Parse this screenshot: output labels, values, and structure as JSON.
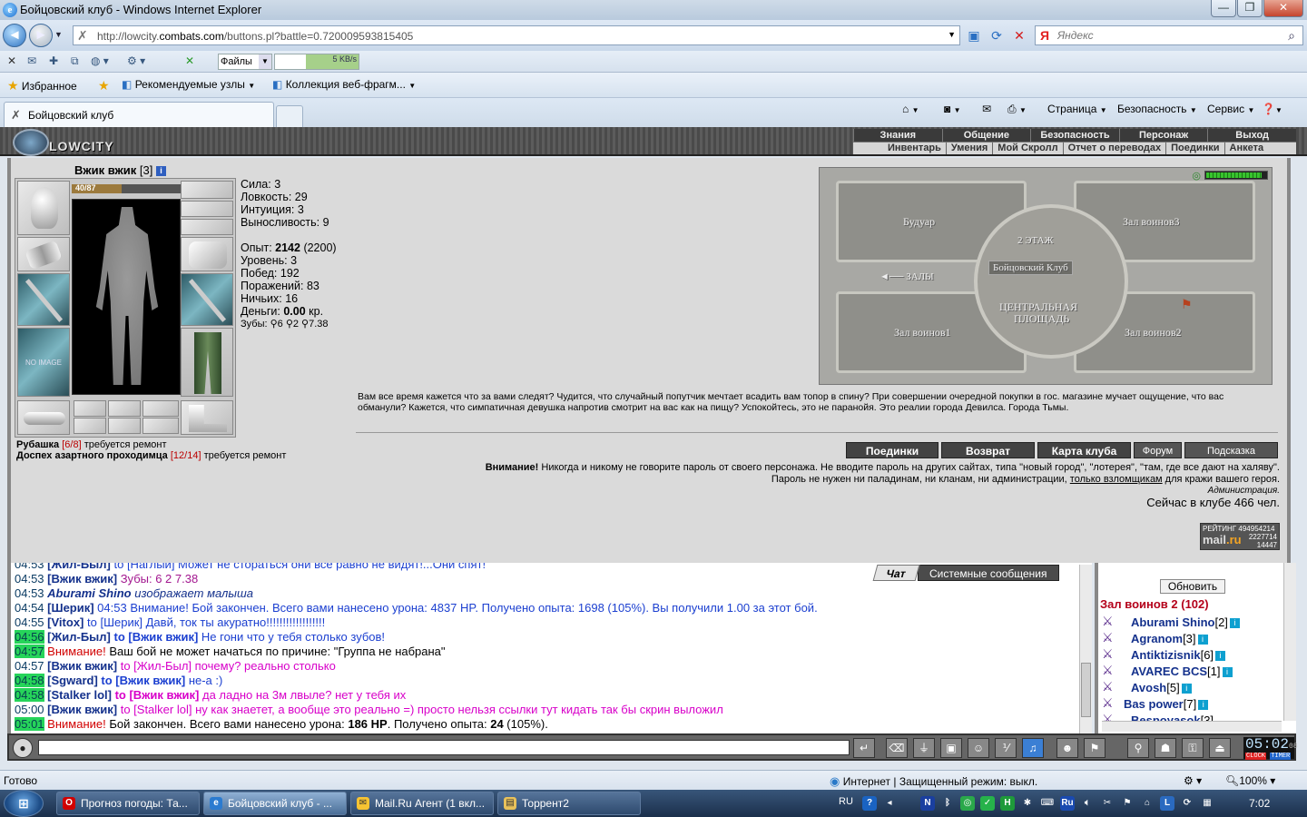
{
  "window": {
    "title": "Бойцовский клуб - Windows Internet Explorer"
  },
  "address": {
    "url_prefix": "http://lowcity.",
    "url_domain": "combats.com",
    "url_path": "/buttons.pl?battle=0.720009593815405",
    "search_placeholder": "Яндекс",
    "search_logo": "Я"
  },
  "toolbar": {
    "files_label": "Файлы",
    "speed_label": "5 KB/s"
  },
  "favorites": {
    "favorites_label": "Избранное",
    "recommended_label": "Рекомендуемые узлы",
    "webslices_label": "Коллекция веб-фрагм..."
  },
  "tab": {
    "label": "Бойцовский клуб"
  },
  "commandbar": {
    "page_label": "Страница",
    "security_label": "Безопасность",
    "service_label": "Сервис"
  },
  "game": {
    "logo": "LOWCITY",
    "menu_top": [
      "Знания",
      "Общение",
      "Безопасность",
      "Персонаж",
      "Выход"
    ],
    "menu_bottom": [
      "Инвентарь",
      "Умения",
      "Мой Скролл",
      "Отчет о переводах",
      "Поединки",
      "Анкета"
    ],
    "character": {
      "name": "Вжик вжик",
      "level": "[3]",
      "hp_text": "40/87",
      "hp_fraction": 0.46,
      "no_image": "NO IMAGE"
    },
    "stats": {
      "strength": "Сила: 3",
      "agility": "Ловкость: 29",
      "intuition": "Интуиция: 3",
      "endurance": "Выносливость: 9",
      "exp_label": "Опыт: ",
      "exp_value": "2142",
      "exp_next": " (2200)",
      "level": "Уровень: 3",
      "wins": "Побед: 192",
      "losses": "Поражений: 83",
      "draws": "Ничьих: 16",
      "money_label": "Деньги: ",
      "money_value": "0.00",
      "money_unit": " кр.",
      "teeth": "Зубы: ⚲6 ⚲2 ⚲7.38"
    },
    "repairs": [
      {
        "item": "Рубашка",
        "dur": "[6/8]",
        "note": " требуется ремонт"
      },
      {
        "item": "Доспех азартного проходимца",
        "dur": "[12/14]",
        "note": " требуется ремонт"
      }
    ],
    "map": {
      "boudoir": "Будуар",
      "hall3": "Зал воинов3",
      "floor2": "2 ЭТАЖ",
      "club": "Бойцовский Клуб",
      "halls": "◄── ЗАЛЫ",
      "central1": "ЦЕНТРАЛЬНАЯ",
      "central2": "ПЛОЩАДЬ",
      "hall1": "Зал воинов1",
      "hall2": "Зал воинов2",
      "hp_fraction": 0.9
    },
    "flavor_text": "Вам все время кажется что за вами следят? Чудится, что случайный попутчик мечтает всадить вам топор в спину? При совершении очередной покупки в гос. магазине мучает ощущение, что вас обманули? Кажется, что симпатичная девушка напротив смотрит на вас как на пищу? Успокойтесь, это не паранойя. Это реалии города Девилса. Города Тьмы.",
    "buttons": {
      "duels": "Поединки",
      "back": "Возврат",
      "club_map": "Карта клуба",
      "forum": "Форум",
      "hint": "Подсказка"
    },
    "warning": {
      "bold": "Внимание!",
      "line1": " Никогда и никому не говорите пароль от своего персонажа. Не вводите пароль на других сайтах, типа \"новый город\", \"лотерея\", \"там, где все дают на халяву\".",
      "line2a": "Пароль не нужен ни паладинам, ни кланам, ни администрации, ",
      "line2link": "только взломщикам",
      "line2b": " для кражи вашего героя."
    },
    "admin": "Администрация.",
    "online": "Сейчас в клубе 466 чел.",
    "rating": {
      "label": "РЕЙТИНГ",
      "n1": "494954214",
      "n2": "2227714",
      "n3": "14447",
      "mail": "mail",
      "ru": ".ru"
    }
  },
  "chat": {
    "tab_chat": "Чат",
    "tab_system": "Системные сообщения",
    "lines": [
      {
        "t": "04:53",
        "hl": false,
        "n": "[Жил-Был]",
        "to": " to [Наглый]",
        "msg": " Может не стораться они все равно не видят!...Они спят!"
      },
      {
        "t": "04:53",
        "hl": false,
        "n": "[Вжик вжик]",
        "msg": " Зубы: 6 2 7.38"
      },
      {
        "t": "04:53",
        "hl": false,
        "emote_n": "Aburami Shino",
        "emote": " изображает малыша"
      },
      {
        "t": "04:54",
        "hl": false,
        "n": "[Шерик]",
        "msg": " 04:53 Внимание! Бой закончен. Всего вами нанесено урона: 4837 HP. Получено опыта: 1698 (105%). Вы получили 1.00 за этот бой."
      },
      {
        "t": "04:55",
        "hl": false,
        "n": "[Vitox]",
        "to": " to [Шерик]",
        "msg": " Давй, ток ты акуратно!!!!!!!!!!!!!!!!!!"
      },
      {
        "t": "04:56",
        "hl": true,
        "n": "[Жил-Был]",
        "to_b": " to [Вжик вжик]",
        "msg": " Не гони что у тебя столько зубов!"
      },
      {
        "t": "04:57",
        "hl": true,
        "red": "Внимание!",
        "msg": " Ваш бой не может начаться по причине: \"Группа не набрана\""
      },
      {
        "t": "04:57",
        "hl": false,
        "n": "[Вжик вжик]",
        "to": " to [Жил-Был]",
        "msg": " почему? реально столько"
      },
      {
        "t": "04:58",
        "hl": true,
        "n": "[Sgward]",
        "to_b": " to [Вжик вжик]",
        "msg": " не-а :)"
      },
      {
        "t": "04:58",
        "hl": true,
        "n": "[Stalker lol]",
        "to_b": " to [Вжик вжик]",
        "msg": " да ладно на 3м лвыле? нет у тебя их"
      },
      {
        "t": "05:00",
        "hl": false,
        "n": "[Вжик вжик]",
        "to": " to [Stalker lol]",
        "msg": " ну как знаетет, а вообще это реально =) просто нельзя ссылки тут кидать так бы скрин выложил"
      },
      {
        "t": "05:01",
        "hl": true,
        "red": "Внимание!",
        "msg": " Бой закончен. Всего вами нанесено урона: ",
        "msg_b1": "186 HP",
        "msg2": ". Получено опыта: ",
        "msg_b2": "24",
        "msg3": " (105%)."
      }
    ]
  },
  "side": {
    "refresh": "Обновить",
    "room": "Зал воинов 2 (102)",
    "players": [
      {
        "name": "Aburami Shino",
        "lvl": "[2]"
      },
      {
        "name": "Agranom",
        "lvl": "[3]"
      },
      {
        "name": "Antiktizisnik",
        "lvl": "[6]"
      },
      {
        "name": "AVAREC BCS",
        "lvl": "[1]"
      },
      {
        "name": "Avosh",
        "lvl": "[5]"
      },
      {
        "name": "Bas power",
        "lvl": "[7]"
      },
      {
        "name": "Bespoyasok",
        "lvl": "[3]"
      }
    ]
  },
  "clock": {
    "time": "05:02",
    "sec": "08",
    "clock_label": "CLOCK",
    "timer_label": "TIMER"
  },
  "statusbar": {
    "ready": "Готово",
    "zone": "Интернет | Защищенный режим: выкл.",
    "zoom": "100%"
  },
  "taskbar": {
    "tasks": [
      "Прогноз погоды: Та...",
      "Бойцовский клуб - ...",
      "Mail.Ru Агент (1 вкл...",
      "Торрент2"
    ],
    "lang": "RU",
    "time": "7:02"
  }
}
